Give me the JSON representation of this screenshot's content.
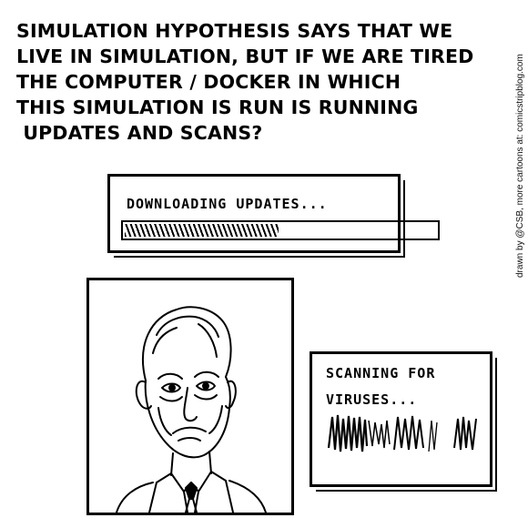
{
  "caption": {
    "lines": [
      "SIMULATION HYPOTHESIS SAYS THAT WE",
      "LIVE IN SIMULATION, BUT IF WE ARE TIRED",
      "THE COMPUTER / DOCKER IN WHICH",
      "THIS SIMULATION IS RUN IS RUNNING",
      " UPDATES AND SCANS?"
    ]
  },
  "credit": "drawn by @CSB, more cartoons at: comicstripblog.com",
  "update_dialog": {
    "label": "DOWNLOADING UPDATES...",
    "progress_fraction": 0.5
  },
  "scan_dialog": {
    "line1": "SCANNING FOR",
    "line2": "VIRUSES..."
  },
  "colors": {
    "ink": "#000000",
    "paper": "#ffffff"
  },
  "portrait": {
    "subject": "tired-man-illustration"
  }
}
